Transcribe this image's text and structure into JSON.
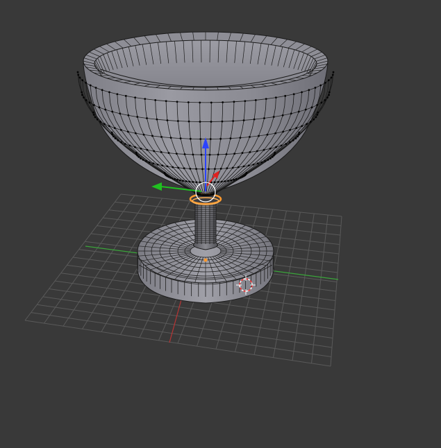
{
  "viewport": {
    "background": "#393939",
    "grid_color": "#5a5a5a",
    "x_axis_color": "#b83434",
    "y_axis_color": "#3aa53a"
  },
  "object": {
    "type": "goblet mesh",
    "mode": "edit",
    "face_color": "#8f8f97",
    "edge_color": "#1a1a1a",
    "vertex_color": "#000000",
    "selected_color": "#ff9a2e"
  },
  "gizmo": {
    "z_arrow_color": "#2b43ff",
    "x_arrow_color": "#e02020",
    "y_arrow_color": "#20c020",
    "ring_color": "#ffffff"
  },
  "cursor_3d": {
    "colors": [
      "#ff3030",
      "#ffffff"
    ]
  }
}
